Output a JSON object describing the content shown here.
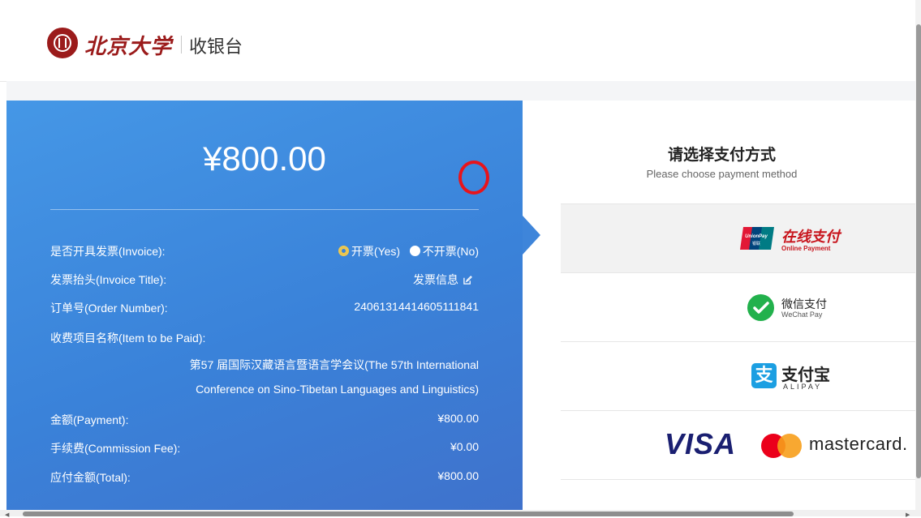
{
  "header": {
    "university_name": "北京大学",
    "cashier_title": "收银台"
  },
  "order": {
    "big_amount": "¥800.00",
    "rows": {
      "invoice": {
        "label": "是否开具发票(Invoice):",
        "opt_yes": "开票(Yes)",
        "opt_no": "不开票(No)",
        "selected": "yes"
      },
      "invoice_title": {
        "label": "发票抬头(Invoice Title):",
        "value": "发票信息"
      },
      "order_number": {
        "label": "订单号(Order Number):",
        "value": "24061314414605111841"
      },
      "item": {
        "label": "收费项目名称(Item to be Paid):",
        "line1": "第57 届国际汉藏语言暨语言学会议(The 57th International",
        "line2": "Conference on Sino-Tibetan Languages and Linguistics)"
      },
      "payment": {
        "label": "金额(Payment):",
        "value": "¥800.00"
      },
      "fee": {
        "label": "手续费(Commission Fee):",
        "value": "¥0.00"
      },
      "total": {
        "label": "应付金额(Total):",
        "value": "¥800.00"
      }
    }
  },
  "payment_methods": {
    "title": "请选择支付方式",
    "subtitle": "Please choose payment method",
    "unionpay": {
      "icon": "unionpay-logo-icon",
      "text": "在线支付",
      "sub": "Online Payment"
    },
    "wechat": {
      "icon": "wechat-pay-icon",
      "text": "微信支付",
      "sub": "WeChat Pay"
    },
    "alipay": {
      "icon": "alipay-icon",
      "glyph": "支",
      "text": "支付宝",
      "sub": "ALIPAY"
    },
    "card": {
      "visa": "VISA",
      "mastercard": "mastercard."
    }
  },
  "colors": {
    "panel_blue": "#3a82d9",
    "brand_red": "#9b1b1b",
    "annotation_red": "#e8141b"
  }
}
